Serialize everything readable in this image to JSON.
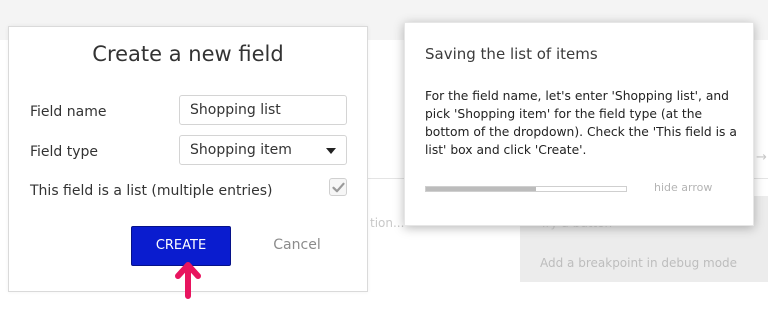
{
  "background": {
    "ghost_text": "tion...",
    "panel_items": [
      "Try a button",
      "Add a breakpoint in debug mode"
    ],
    "right_arrow": "→"
  },
  "dialog": {
    "title": "Create a new field",
    "field_name_label": "Field name",
    "field_name_value": "Shopping list",
    "field_type_label": "Field type",
    "field_type_value": "Shopping item",
    "is_list_label": "This field is a list (multiple entries)",
    "is_list_checked": true,
    "create_label": "CREATE",
    "cancel_label": "Cancel",
    "create_color": "#0a1ccf",
    "pointer_color": "#e8145f"
  },
  "tutorial": {
    "title": "Saving the list of items",
    "body": "For the field name, let's enter 'Shopping list', and pick 'Shopping item' for the field type (at the bottom of the dropdown). Check the 'This field is a list' box and click 'Create'.",
    "progress": 0.55,
    "hide_arrow_label": "hide arrow"
  },
  "icons": [
    "caret-down-icon",
    "checkmark-icon",
    "pointer-arrow-icon"
  ]
}
